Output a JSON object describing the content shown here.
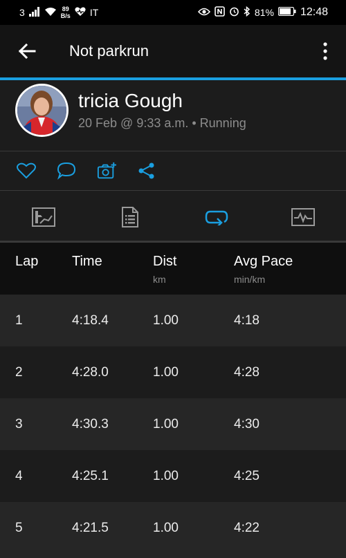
{
  "status_bar": {
    "carrier": "3",
    "speed_value": "89",
    "speed_unit": "B/s",
    "region": "IT",
    "battery": "81%",
    "time": "12:48"
  },
  "app_bar": {
    "title": "Not parkrun"
  },
  "activity": {
    "user_name": "tricia Gough",
    "meta": "20 Feb @ 9:33 a.m. • Running"
  },
  "icons": {
    "actions": [
      "heart-icon",
      "comment-icon",
      "add-photo-icon",
      "share-icon"
    ],
    "tabs": [
      "overview-tab-icon",
      "details-tab-icon",
      "laps-tab-icon",
      "chart-tab-icon"
    ]
  },
  "colors": {
    "accent": "#1a9fe0",
    "background": "#1c1c1c",
    "header_bg": "#0f0f0f",
    "row_alt": "#262626",
    "muted_text": "#8c8c8c"
  },
  "laps_table": {
    "columns": [
      {
        "label": "Lap",
        "unit": ""
      },
      {
        "label": "Time",
        "unit": ""
      },
      {
        "label": "Dist",
        "unit": "km"
      },
      {
        "label": "Avg Pace",
        "unit": "min/km"
      }
    ],
    "rows": [
      {
        "lap": "1",
        "time": "4:18.4",
        "dist": "1.00",
        "pace": "4:18"
      },
      {
        "lap": "2",
        "time": "4:28.0",
        "dist": "1.00",
        "pace": "4:28"
      },
      {
        "lap": "3",
        "time": "4:30.3",
        "dist": "1.00",
        "pace": "4:30"
      },
      {
        "lap": "4",
        "time": "4:25.1",
        "dist": "1.00",
        "pace": "4:25"
      },
      {
        "lap": "5",
        "time": "4:21.5",
        "dist": "1.00",
        "pace": "4:22"
      }
    ]
  }
}
